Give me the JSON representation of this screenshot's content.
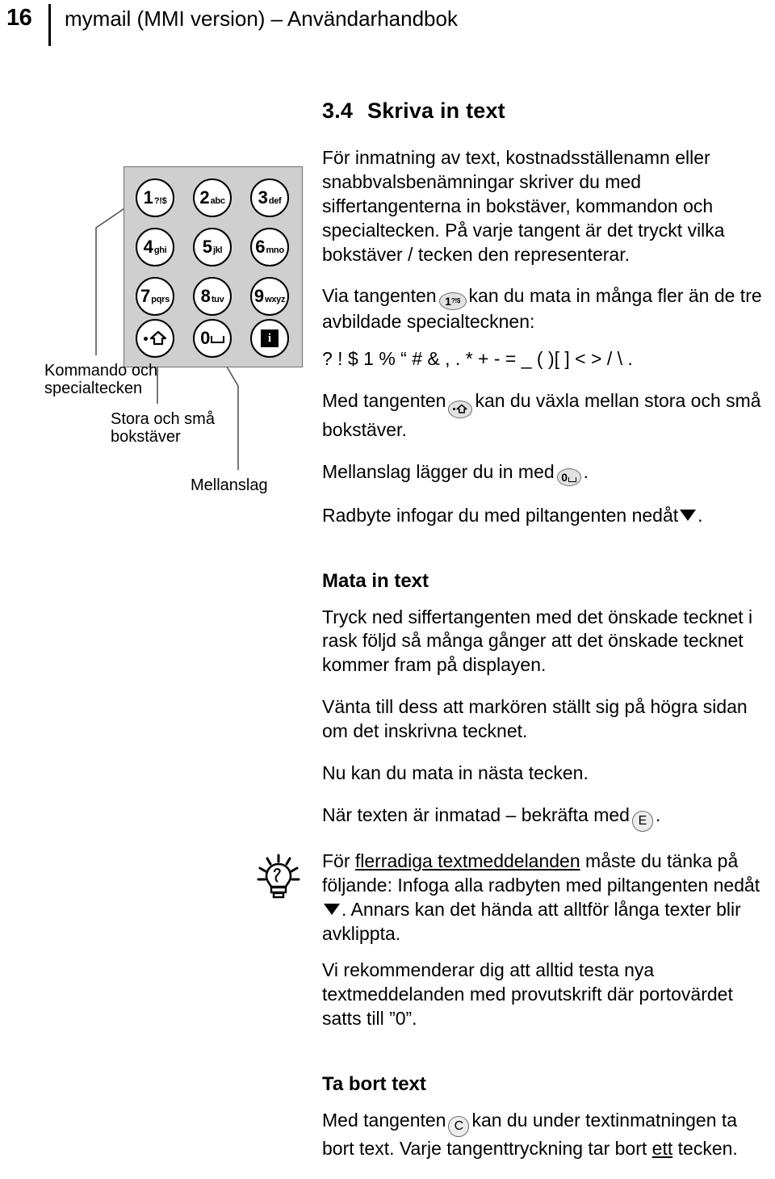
{
  "header": {
    "page_number": "16",
    "title": "mymail (MMI version) – Användarhandbok"
  },
  "figure": {
    "keys": [
      {
        "digit": "1",
        "letters": "?!$",
        "name": "key-1"
      },
      {
        "digit": "2",
        "letters": "abc",
        "name": "key-2"
      },
      {
        "digit": "3",
        "letters": "def",
        "name": "key-3"
      },
      {
        "digit": "4",
        "letters": "ghi",
        "name": "key-4"
      },
      {
        "digit": "5",
        "letters": "jkl",
        "name": "key-5"
      },
      {
        "digit": "6",
        "letters": "mno",
        "name": "key-6"
      },
      {
        "digit": "7",
        "letters": "pqrs",
        "name": "key-7"
      },
      {
        "digit": "8",
        "letters": "tuv",
        "name": "key-8"
      },
      {
        "digit": "9",
        "letters": "wxyz",
        "name": "key-9"
      },
      {
        "digit": "",
        "letters": "",
        "name": "key-shift"
      },
      {
        "digit": "0",
        "letters": "",
        "name": "key-space"
      },
      {
        "digit": "i",
        "letters": "",
        "name": "key-info"
      }
    ],
    "callouts": {
      "kommando_line1": "Kommando och",
      "kommando_line2": "specialtecken",
      "stora_line1": "Stora och små",
      "stora_line2": "bokstäver",
      "mellanslag": "Mellanslag"
    }
  },
  "content": {
    "section_number": "3.4",
    "section_title": "Skriva in text",
    "intro": "För inmatning av text, kostnadsställenamn eller snabbvalsbenämningar skriver du med siffertangenterna in bokstäver, kommandon och specialtecken. På varje tangent är det tryckt vilka bokstäver / tecken den representerar.",
    "via_tangenten_pre": "Via tangenten",
    "via_tangenten_post": "kan du mata in många fler än de tre avbildade specialtecknen:",
    "special_chars": "? ! $ 1 % “ # & , . * + - = _ ( )[ ] < > / \\ .",
    "med_tangenten_shift_pre": "Med tangenten",
    "med_tangenten_shift_post": "kan du växla mellan stora och små bokstäver.",
    "mellanslag_pre": "Mellanslag lägger du in med",
    "mellanslag_post": ".",
    "radbyte_pre": "Radbyte infogar du med piltangenten nedåt",
    "radbyte_post": ".",
    "mata_in_text_title": "Mata in text",
    "mata_p1": "Tryck ned siffertangenten med det önskade tecknet i rask följd så många gånger att det önskade tecknet kommer fram på displayen.",
    "mata_p2": "Vänta till dess att markören ställt sig på högra sidan om det inskrivna tecknet.",
    "mata_p3": "Nu kan du mata in nästa tecken.",
    "mata_p4_pre": "När texten är inmatad – bekräfta med",
    "mata_p4_post": ".",
    "enter_key_label": "E",
    "tip": {
      "lead": "För",
      "underlined": "flerradiga textmeddelanden",
      "after_underline": "måste du tänka på följande: Infoga alla radbyten med piltangenten nedåt",
      "after_arrow": ". Annars kan det hända att alltför långa texter blir avklippta.",
      "last_paragraph": "Vi rekommenderar dig att alltid testa nya textmeddelanden med provutskrift där portovärdet satts till ”0”."
    },
    "ta_bort_text_title": "Ta bort text",
    "ta_bort_pre": "Med tangenten",
    "ta_bort_mid": "kan du under textinmatningen ta bort text. Varje tangenttryckning tar bort",
    "ta_bort_underlined": "ett",
    "ta_bort_post": "tecken.",
    "clear_key_label": "C"
  }
}
